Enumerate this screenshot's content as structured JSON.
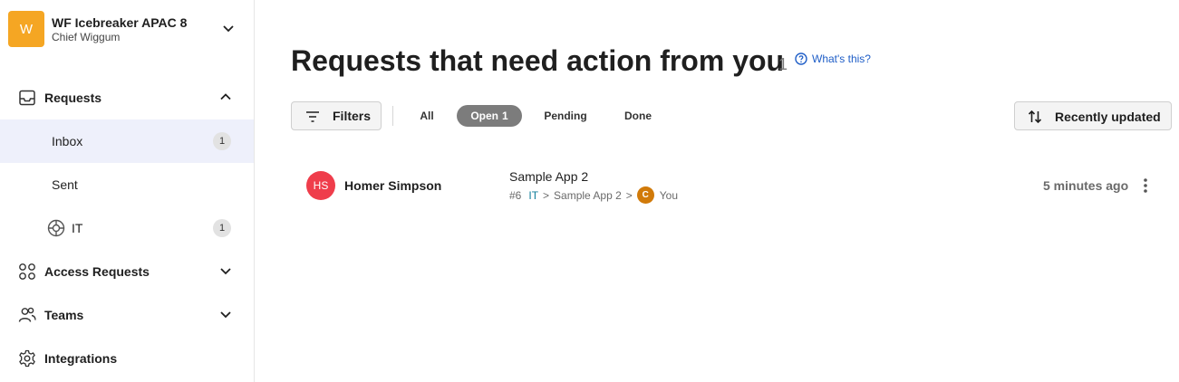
{
  "org": {
    "avatar_initial": "W",
    "name": "WF Icebreaker APAC 8",
    "user": "Chief Wiggum"
  },
  "sidebar": {
    "items": [
      {
        "label": "Requests",
        "icon": "inbox-tray-icon",
        "expanded": true
      },
      {
        "label": "Inbox",
        "badge": "1",
        "selected": true
      },
      {
        "label": "Sent"
      },
      {
        "label": "IT",
        "icon": "lifebuoy-icon",
        "badge": "1"
      },
      {
        "label": "Access Requests",
        "icon": "grid-circles-icon",
        "expanded": false
      },
      {
        "label": "Teams",
        "icon": "people-icon",
        "expanded": false
      },
      {
        "label": "Integrations",
        "icon": "gear-icon"
      }
    ]
  },
  "main": {
    "title": "Requests that need action from you",
    "title_count": "1",
    "whats_this": "What's this?",
    "filters_label": "Filters",
    "tabs": [
      {
        "label": "All"
      },
      {
        "label": "Open",
        "count": "1",
        "active": true
      },
      {
        "label": "Pending"
      },
      {
        "label": "Done"
      }
    ],
    "sort_label": "Recently updated",
    "requests": [
      {
        "requester_initials": "HS",
        "requester_name": "Homer Simpson",
        "app": "Sample App 2",
        "number": "#6",
        "team": "IT",
        "path_app": "Sample App 2",
        "assignee_initial": "C",
        "assignee_label": "You",
        "time": "5 minutes ago"
      }
    ]
  },
  "colors": {
    "org_avatar": "#f5a623",
    "selected_bg": "#eef0fb",
    "link": "#1f5ec7",
    "active_tab": "#7c7c7c",
    "requester_avatar": "#ef3d4b",
    "assignee_avatar": "#d17a09",
    "team_link": "#0f7e9b"
  }
}
